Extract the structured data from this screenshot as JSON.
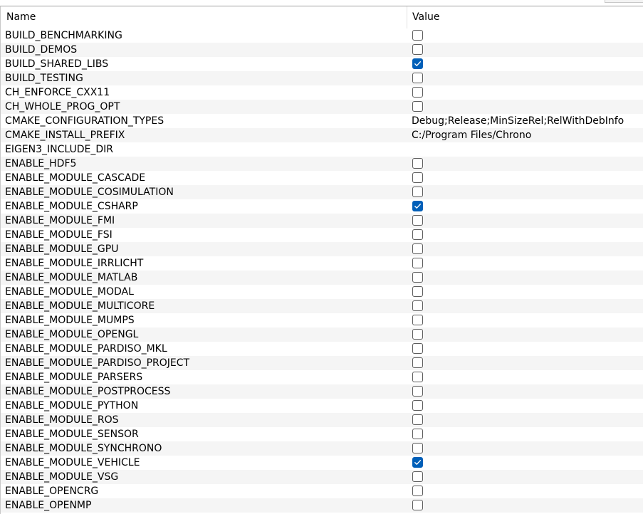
{
  "header": {
    "name_label": "Name",
    "value_label": "Value"
  },
  "colors": {
    "checkbox_checked": "#005fb8",
    "row_alt": "#f5f5f5"
  },
  "rows": [
    {
      "name": "BUILD_BENCHMARKING",
      "type": "bool",
      "checked": false
    },
    {
      "name": "BUILD_DEMOS",
      "type": "bool",
      "checked": false
    },
    {
      "name": "BUILD_SHARED_LIBS",
      "type": "bool",
      "checked": true
    },
    {
      "name": "BUILD_TESTING",
      "type": "bool",
      "checked": false
    },
    {
      "name": "CH_ENFORCE_CXX11",
      "type": "bool",
      "checked": false
    },
    {
      "name": "CH_WHOLE_PROG_OPT",
      "type": "bool",
      "checked": false
    },
    {
      "name": "CMAKE_CONFIGURATION_TYPES",
      "type": "string",
      "value": "Debug;Release;MinSizeRel;RelWithDebInfo"
    },
    {
      "name": "CMAKE_INSTALL_PREFIX",
      "type": "string",
      "value": "C:/Program Files/Chrono"
    },
    {
      "name": "EIGEN3_INCLUDE_DIR",
      "type": "string",
      "value": ""
    },
    {
      "name": "ENABLE_HDF5",
      "type": "bool",
      "checked": false
    },
    {
      "name": "ENABLE_MODULE_CASCADE",
      "type": "bool",
      "checked": false
    },
    {
      "name": "ENABLE_MODULE_COSIMULATION",
      "type": "bool",
      "checked": false
    },
    {
      "name": "ENABLE_MODULE_CSHARP",
      "type": "bool",
      "checked": true
    },
    {
      "name": "ENABLE_MODULE_FMI",
      "type": "bool",
      "checked": false
    },
    {
      "name": "ENABLE_MODULE_FSI",
      "type": "bool",
      "checked": false
    },
    {
      "name": "ENABLE_MODULE_GPU",
      "type": "bool",
      "checked": false
    },
    {
      "name": "ENABLE_MODULE_IRRLICHT",
      "type": "bool",
      "checked": false
    },
    {
      "name": "ENABLE_MODULE_MATLAB",
      "type": "bool",
      "checked": false
    },
    {
      "name": "ENABLE_MODULE_MODAL",
      "type": "bool",
      "checked": false
    },
    {
      "name": "ENABLE_MODULE_MULTICORE",
      "type": "bool",
      "checked": false
    },
    {
      "name": "ENABLE_MODULE_MUMPS",
      "type": "bool",
      "checked": false
    },
    {
      "name": "ENABLE_MODULE_OPENGL",
      "type": "bool",
      "checked": false
    },
    {
      "name": "ENABLE_MODULE_PARDISO_MKL",
      "type": "bool",
      "checked": false
    },
    {
      "name": "ENABLE_MODULE_PARDISO_PROJECT",
      "type": "bool",
      "checked": false
    },
    {
      "name": "ENABLE_MODULE_PARSERS",
      "type": "bool",
      "checked": false
    },
    {
      "name": "ENABLE_MODULE_POSTPROCESS",
      "type": "bool",
      "checked": false
    },
    {
      "name": "ENABLE_MODULE_PYTHON",
      "type": "bool",
      "checked": false
    },
    {
      "name": "ENABLE_MODULE_ROS",
      "type": "bool",
      "checked": false
    },
    {
      "name": "ENABLE_MODULE_SENSOR",
      "type": "bool",
      "checked": false
    },
    {
      "name": "ENABLE_MODULE_SYNCHRONO",
      "type": "bool",
      "checked": false
    },
    {
      "name": "ENABLE_MODULE_VEHICLE",
      "type": "bool",
      "checked": true
    },
    {
      "name": "ENABLE_MODULE_VSG",
      "type": "bool",
      "checked": false
    },
    {
      "name": "ENABLE_OPENCRG",
      "type": "bool",
      "checked": false
    },
    {
      "name": "ENABLE_OPENMP",
      "type": "bool",
      "checked": false
    }
  ]
}
